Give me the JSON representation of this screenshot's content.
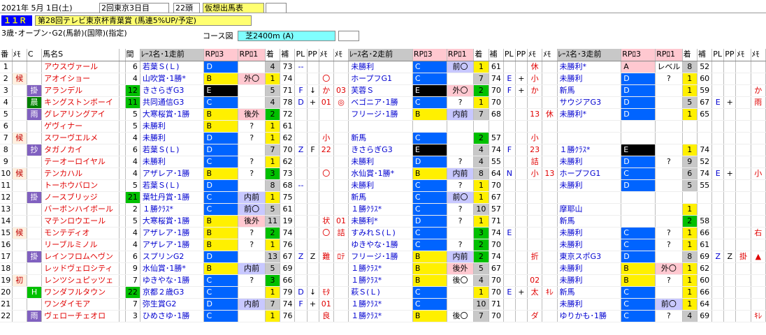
{
  "header": {
    "date": "2021年 5月 1日(土)",
    "meeting": "2回東京3日目",
    "field_size": "22頭",
    "card_type": "仮想出馬表",
    "race_no": "１１Ｒ",
    "race_name": "第28回テレビ東京杯青葉賞 (馬連5%UP/予定)",
    "conditions": "3歳･オープン･G2(馬齢)(国際)(指定)",
    "course_label": "コース図",
    "course": "芝2400m (A)"
  },
  "columns": [
    "番",
    "ﾒﾓ",
    "C",
    "馬名S",
    "",
    "間",
    "ﾚｰｽ名･1走前",
    "RPﾛ3",
    "RPﾛ1",
    "着",
    "補",
    "PL",
    "PP",
    "ﾒﾓ",
    "ﾒﾓ",
    "ﾚｰｽ名･2走前",
    "RPﾛ3",
    "RPﾛ1",
    "着",
    "補",
    "PL",
    "PP",
    "ﾒﾓ",
    "ﾒﾓ",
    "ﾚｰｽ名･3走前",
    "RPﾛ3",
    "RPﾛ1",
    "着",
    "補",
    "PL",
    "PP",
    "ﾒﾓ",
    "ﾒﾓ"
  ],
  "colors": {
    "blue_cell": "#0064ff",
    "black_cell": "#000000",
    "yellow_cell": "#fff000",
    "green_cell": "#00c000",
    "gray_cell": "#c8c8c8",
    "pink_cell": "#ffc8d0",
    "lilac_cell": "#c8c8ff",
    "ltblue_cell": "#8cc8ff",
    "cyan_cell": "#80ffff",
    "yellow_hdr": "#ffff70",
    "blue_hdr": "#0000ff",
    "race_no_text": "#ffff00"
  },
  "rows": [
    {
      "no": "1",
      "memo": "",
      "c": "",
      "name": "アウスヴァール",
      "nbadge": "",
      "iv": "6",
      "r1": [
        "若葉Ｓ(Ｌ)",
        "D",
        "",
        "",
        "4",
        "73",
        "--",
        "",
        "",
        ""
      ],
      "r2": [
        "未勝利",
        "C",
        "前〇",
        "",
        "1",
        "61",
        "",
        "",
        "休",
        ""
      ],
      "r3": [
        "未勝利*",
        "A",
        "レベル",
        "",
        "8",
        "52",
        "",
        "",
        "",
        ""
      ]
    },
    {
      "no": "2",
      "memo": "候",
      "c": "",
      "name": "アオイショー",
      "nbadge": "",
      "iv": "4",
      "r1": [
        "山吹賞･1勝*",
        "B",
        "外〇",
        "",
        "1",
        "74",
        "",
        "",
        "〇",
        ""
      ],
      "r2": [
        "ホープフG1",
        "C",
        "",
        "",
        "7",
        "74",
        "E",
        "+",
        "小",
        ""
      ],
      "r3": [
        "未勝利",
        "D",
        "?",
        "",
        "1",
        "60",
        "",
        "",
        "",
        ""
      ]
    },
    {
      "no": "3",
      "memo": "",
      "c": "掛",
      "name": "アランデル",
      "nbadge": "",
      "iv": "12",
      "r1": [
        "きさらぎG3",
        "E",
        "",
        "",
        "5",
        "71",
        "F",
        "↓",
        "か",
        "03"
      ],
      "r2": [
        "芙蓉Ｓ",
        "E",
        "外〇",
        "",
        "2",
        "70",
        "F",
        "+",
        "か",
        ""
      ],
      "r3": [
        "新馬",
        "D",
        "",
        "",
        "1",
        "59",
        "",
        "",
        "",
        "か"
      ]
    },
    {
      "no": "4",
      "memo": "",
      "c": "晨",
      "name": "キングストンボーイ",
      "nbadge": "",
      "iv": "11",
      "r1": [
        "共同通信G3",
        "C",
        "",
        "",
        "4",
        "78",
        "D",
        "+",
        "01",
        "◎"
      ],
      "r2": [
        "ベゴニア･1勝",
        "C",
        "?",
        "",
        "1",
        "70",
        "",
        "",
        "",
        ""
      ],
      "r3": [
        "サウジアG3",
        "D",
        "",
        "",
        "5",
        "67",
        "E",
        "+",
        "",
        "雨"
      ]
    },
    {
      "no": "5",
      "memo": "",
      "c": "雨",
      "name": "グレアリングアイ",
      "nbadge": "",
      "iv": "5",
      "r1": [
        "大寒桜賞･1勝",
        "B",
        "後外",
        "",
        "2",
        "72",
        "",
        "",
        "",
        ""
      ],
      "r2": [
        "フリージ･1勝",
        "B",
        "内前",
        "",
        "7",
        "68",
        "",
        "",
        "13",
        "休"
      ],
      "r3": [
        "未勝利*",
        "D",
        "",
        "",
        "1",
        "65",
        "",
        "",
        "",
        ""
      ]
    },
    {
      "no": "6",
      "memo": "",
      "c": "",
      "name": "ゲヴィナー",
      "nbadge": "",
      "iv": "5",
      "r1": [
        "未勝利",
        "B",
        "?",
        "",
        "1",
        "61",
        "",
        "",
        "",
        ""
      ],
      "r2": [
        "",
        "",
        "",
        "",
        "",
        "",
        "",
        "",
        "",
        ""
      ],
      "r3": [
        "",
        "",
        "",
        "",
        "",
        "",
        "",
        "",
        "",
        ""
      ]
    },
    {
      "no": "7",
      "memo": "候",
      "c": "",
      "name": "スワーヴエルメ",
      "nbadge": "",
      "iv": "4",
      "r1": [
        "未勝利",
        "D",
        "?",
        "",
        "1",
        "62",
        "",
        "",
        "小",
        ""
      ],
      "r2": [
        "新馬",
        "C",
        "",
        "",
        "2",
        "57",
        "",
        "",
        "小",
        ""
      ],
      "r3": [
        "",
        "",
        "",
        "",
        "",
        "",
        "",
        "",
        "",
        ""
      ]
    },
    {
      "no": "8",
      "memo": "",
      "c": "抄",
      "name": "タガノカイ",
      "nbadge": "",
      "iv": "6",
      "r1": [
        "若葉Ｓ(Ｌ)",
        "D",
        "",
        "",
        "7",
        "70",
        "Z",
        "F",
        "22",
        ""
      ],
      "r2": [
        "きさらぎG3",
        "E",
        "",
        "",
        "4",
        "74",
        "F",
        "",
        "23",
        ""
      ],
      "r3": [
        "１勝ｸﾗｽ*",
        "E",
        "",
        "",
        "1",
        "74",
        "",
        "",
        "",
        ""
      ]
    },
    {
      "no": "9",
      "memo": "",
      "c": "",
      "name": "テーオーロイヤル",
      "nbadge": "",
      "iv": "4",
      "r1": [
        "未勝利",
        "C",
        "?",
        "",
        "1",
        "62",
        "",
        "",
        "",
        ""
      ],
      "r2": [
        "未勝利",
        "D",
        "?",
        "",
        "4",
        "55",
        "",
        "",
        "詰",
        ""
      ],
      "r3": [
        "未勝利",
        "D",
        "?",
        "",
        "9",
        "52",
        "",
        "",
        "",
        ""
      ]
    },
    {
      "no": "10",
      "memo": "候",
      "c": "",
      "name": "テンカハル",
      "nbadge": "",
      "iv": "4",
      "r1": [
        "アザレア･1勝",
        "B",
        "?",
        "",
        "3",
        "73",
        "",
        "",
        "〇",
        ""
      ],
      "r2": [
        "水仙賞･1勝*",
        "B",
        "内前",
        "",
        "8",
        "64",
        "N",
        "",
        "小",
        "13"
      ],
      "r3": [
        "ホープフG1",
        "C",
        "",
        "",
        "6",
        "74",
        "E",
        "+",
        "",
        "小"
      ]
    },
    {
      "no": "11",
      "memo": "",
      "c": "",
      "name": "トーホウバロン",
      "nbadge": "",
      "iv": "5",
      "r1": [
        "若葉Ｓ(Ｌ)",
        "D",
        "",
        "",
        "8",
        "68",
        "--",
        "",
        "",
        ""
      ],
      "r2": [
        "未勝利",
        "C",
        "?",
        "",
        "1",
        "70",
        "",
        "",
        "",
        ""
      ],
      "r3": [
        "未勝利",
        "D",
        "",
        "",
        "5",
        "55",
        "",
        "",
        "",
        ""
      ]
    },
    {
      "no": "12",
      "memo": "",
      "c": "掛",
      "name": "ノースブリッジ",
      "nbadge": "",
      "iv": "21",
      "r1": [
        "葉牡丹賞･1勝",
        "C",
        "内前",
        "",
        "1",
        "75",
        "",
        "",
        "",
        ""
      ],
      "r2": [
        "新馬",
        "C",
        "前〇",
        "",
        "1",
        "67",
        "",
        "",
        "",
        ""
      ],
      "r3": [
        "",
        "",
        "",
        "",
        "",
        "",
        "",
        "",
        "",
        ""
      ]
    },
    {
      "no": "13",
      "memo": "",
      "c": "",
      "name": "バーボンハイボール",
      "nbadge": "",
      "iv": "2",
      "r1": [
        "１勝ｸﾗｽ*",
        "C",
        "前〇",
        "",
        "5",
        "61",
        "",
        "",
        "",
        ""
      ],
      "r2": [
        "１勝ｸﾗｽ*",
        "C",
        "?",
        "",
        "10",
        "57",
        "",
        "",
        "",
        ""
      ],
      "r3": [
        "摩耶山",
        "",
        "",
        "",
        "1",
        "",
        "",
        "",
        "",
        ""
      ]
    },
    {
      "no": "14",
      "memo": "",
      "c": "",
      "name": "マテンロウエール",
      "nbadge": "",
      "iv": "5",
      "r1": [
        "大寒桜賞･1勝",
        "B",
        "後外",
        "",
        "11",
        "19",
        "",
        "",
        "状",
        "01"
      ],
      "r2": [
        "未勝利*",
        "D",
        "?",
        "",
        "1",
        "71",
        "",
        "",
        "",
        ""
      ],
      "r3": [
        "新馬",
        "",
        "",
        "",
        "2",
        "58",
        "",
        "",
        "",
        ""
      ]
    },
    {
      "no": "15",
      "memo": "候",
      "c": "",
      "name": "モンテディオ",
      "nbadge": "",
      "iv": "4",
      "r1": [
        "アザレア･1勝",
        "B",
        "?",
        "",
        "2",
        "74",
        "",
        "",
        "〇",
        "詰"
      ],
      "r2": [
        "すみれＳ(Ｌ)",
        "C",
        "",
        "",
        "3",
        "74",
        "E",
        "",
        "",
        ""
      ],
      "r3": [
        "未勝利",
        "C",
        "?",
        "",
        "1",
        "66",
        "",
        "",
        "",
        "右"
      ]
    },
    {
      "no": "16",
      "memo": "",
      "c": "",
      "name": "リーブルミノル",
      "nbadge": "",
      "iv": "4",
      "r1": [
        "アザレア･1勝",
        "B",
        "?",
        "",
        "1",
        "76",
        "",
        "",
        "",
        ""
      ],
      "r2": [
        "ゆきやな･1勝",
        "C",
        "?",
        "",
        "2",
        "70",
        "",
        "",
        "",
        ""
      ],
      "r3": [
        "未勝利",
        "C",
        "?",
        "",
        "1",
        "61",
        "",
        "",
        "",
        ""
      ]
    },
    {
      "no": "17",
      "memo": "",
      "c": "掛",
      "name": "レインフロムヘヴン",
      "nbadge": "",
      "iv": "6",
      "r1": [
        "スプリンG2",
        "D",
        "",
        "",
        "13",
        "67",
        "Z",
        "Z",
        "難",
        "ﾛﾃ"
      ],
      "r2": [
        "フリージ･1勝",
        "B",
        "内前",
        "",
        "2",
        "74",
        "",
        "",
        "折",
        ""
      ],
      "r3": [
        "東京スポG3",
        "D",
        "",
        "",
        "8",
        "69",
        "Z",
        "Z",
        "掛",
        "▲"
      ]
    },
    {
      "no": "18",
      "memo": "",
      "c": "",
      "name": "レッドヴェロシティ",
      "nbadge": "",
      "iv": "9",
      "r1": [
        "水仙賞･1勝*",
        "B",
        "内前",
        "",
        "5",
        "69",
        "",
        "",
        "",
        ""
      ],
      "r2": [
        "１勝ｸﾗｽ*",
        "B",
        "後外",
        "",
        "5",
        "67",
        "",
        "",
        "",
        ""
      ],
      "r3": [
        "未勝利",
        "B",
        "外〇",
        "",
        "1",
        "62",
        "",
        "",
        "",
        ""
      ]
    },
    {
      "no": "19",
      "memo": "初",
      "c": "",
      "name": "レンツシュピッツェ",
      "nbadge": "",
      "iv": "7",
      "r1": [
        "ゆきやな･1勝",
        "C",
        "?",
        "",
        "3",
        "66",
        "",
        "",
        "",
        ""
      ],
      "r2": [
        "１勝ｸﾗｽ*",
        "B",
        "後〇",
        "",
        "4",
        "70",
        "",
        "",
        "02",
        ""
      ],
      "r3": [
        "未勝利",
        "B",
        "?",
        "",
        "1",
        "60",
        "",
        "",
        "",
        ""
      ]
    },
    {
      "no": "20",
      "memo": "",
      "c": "H",
      "name": "ワンダフルタウン",
      "nbadge": "",
      "iv": "22",
      "r1": [
        "京都２歳G3",
        "C",
        "",
        "",
        "1",
        "79",
        "D",
        "↓",
        "ﾓﾀ",
        ""
      ],
      "r2": [
        "萩Ｓ(Ｌ)",
        "C",
        "",
        "",
        "1",
        "70",
        "E",
        "+",
        "太",
        "ｷﾚ"
      ],
      "r3": [
        "新馬",
        "C",
        "",
        "",
        "1",
        "66",
        "",
        "",
        "",
        ""
      ]
    },
    {
      "no": "21",
      "memo": "",
      "c": "",
      "name": "ワンダイモア",
      "nbadge": "",
      "iv": "7",
      "r1": [
        "弥生賞G2",
        "D",
        "内前",
        "",
        "7",
        "74",
        "F",
        "+",
        "01",
        ""
      ],
      "r2": [
        "１勝ｸﾗｽ*",
        "C",
        "",
        "",
        "10",
        "71",
        "",
        "",
        "",
        ""
      ],
      "r3": [
        "未勝利",
        "C",
        "前〇",
        "",
        "1",
        "64",
        "",
        "",
        "",
        ""
      ]
    },
    {
      "no": "22",
      "memo": "",
      "c": "雨",
      "name": "ヴェローチェオロ",
      "nbadge": "",
      "iv": "3",
      "r1": [
        "ひめさゆ･1勝",
        "C",
        "",
        "",
        "1",
        "76",
        "",
        "",
        "良",
        ""
      ],
      "r2": [
        "１勝ｸﾗｽ*",
        "B",
        "後〇",
        "",
        "7",
        "70",
        "",
        "",
        "ダ",
        ""
      ],
      "r3": [
        "ゆりかも･1勝",
        "C",
        "?",
        "",
        "4",
        "69",
        "",
        "",
        "",
        "ｷﾚ"
      ]
    }
  ]
}
